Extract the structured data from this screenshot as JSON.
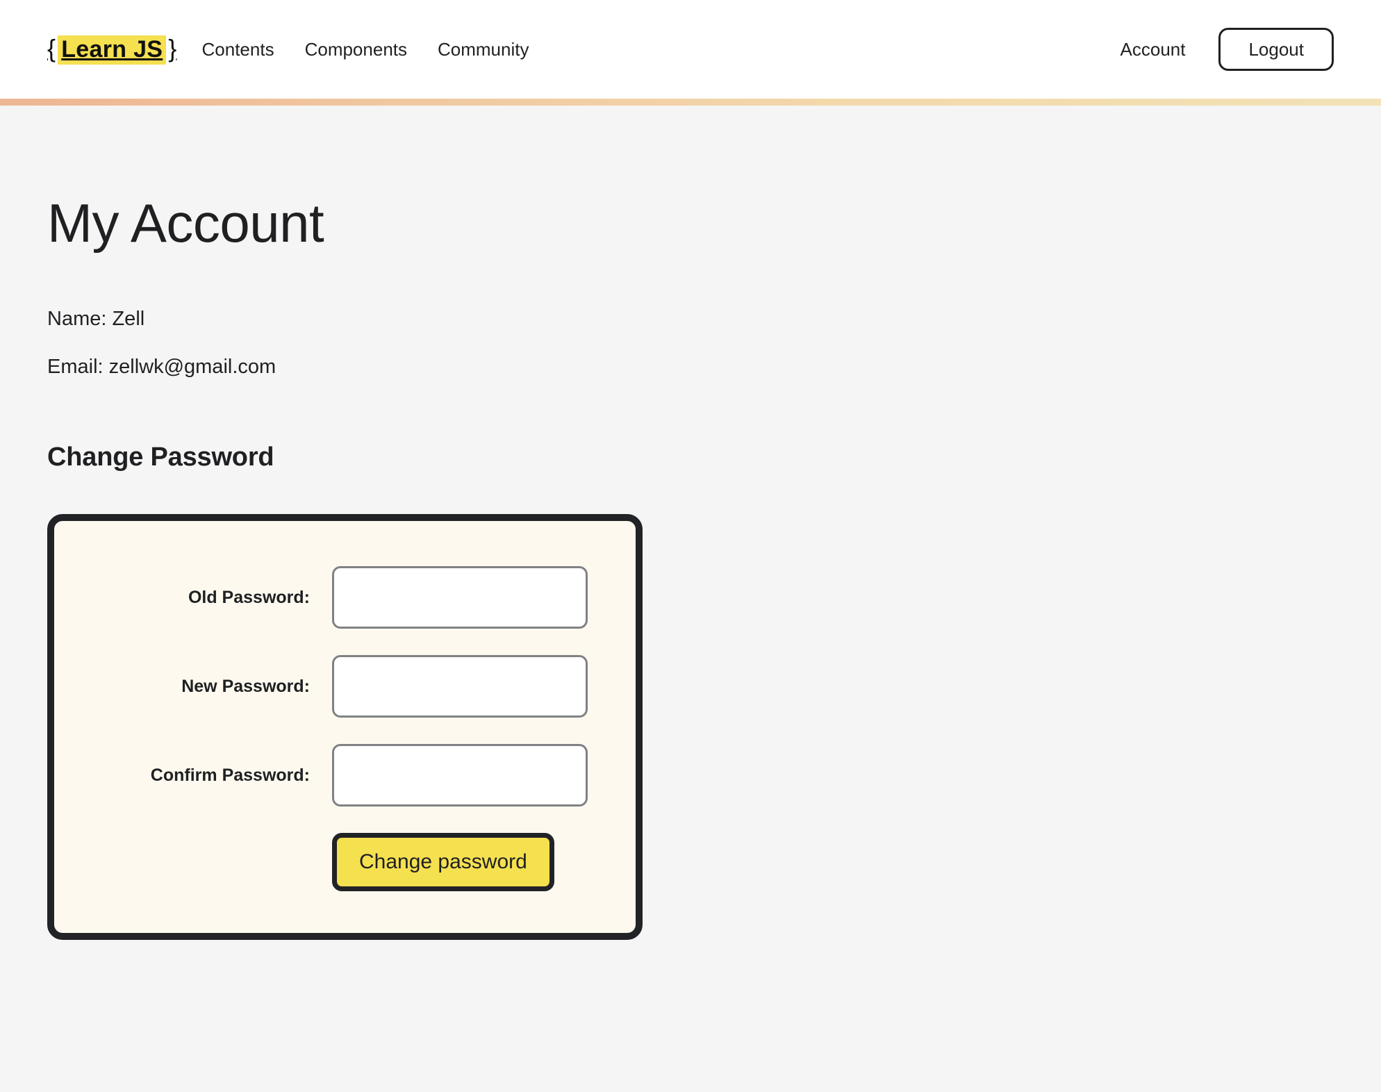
{
  "header": {
    "brand": {
      "open_brace": "{",
      "mark": "Learn JS",
      "close_brace": "}"
    },
    "nav": [
      {
        "label": "Contents"
      },
      {
        "label": "Components"
      },
      {
        "label": "Community"
      }
    ],
    "account_label": "Account",
    "logout_label": "Logout",
    "accent_bar": {
      "from_color": "#eeb693",
      "to_color": "#f2e2b6"
    }
  },
  "main": {
    "page_title": "My Account",
    "name_line": "Name: Zell",
    "email_line": "Email: zellwk@gmail.com",
    "section_title": "Change Password",
    "form": {
      "fields": [
        {
          "label": "Old Password:",
          "value": "",
          "placeholder": ""
        },
        {
          "label": "New Password:",
          "value": "",
          "placeholder": ""
        },
        {
          "label": "Confirm Password:",
          "value": "",
          "placeholder": ""
        }
      ],
      "submit_label": "Change password"
    }
  },
  "colors": {
    "brand_yellow": "#f5e050",
    "card_background": "#fdf9ef",
    "card_border": "#222326",
    "page_background": "#f5f5f6",
    "text": "#1f2022",
    "input_border": "#808184"
  }
}
